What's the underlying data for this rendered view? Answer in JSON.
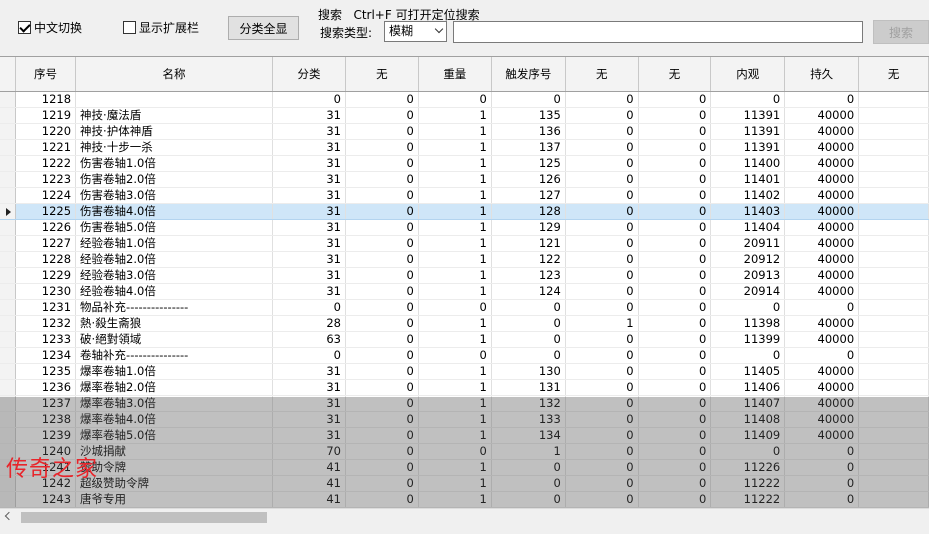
{
  "toolbar": {
    "chinese_toggle_label": "中文切换",
    "chinese_toggle_checked": true,
    "show_ext_label": "显示扩展栏",
    "show_ext_checked": false,
    "show_all_label": "分类全显",
    "search_title": "搜索   Ctrl+F 可打开定位搜索",
    "search_type_label": "搜索类型:",
    "search_type_value": "模糊",
    "search_value": "",
    "search_button": "搜索"
  },
  "table": {
    "columns": [
      "序号",
      "名称",
      "分类",
      "无",
      "重量",
      "触发序号",
      "无",
      "无",
      "内观",
      "持久",
      "无"
    ],
    "selected_index": 7,
    "rows": [
      [
        "1218",
        "",
        "0",
        "0",
        "0",
        "0",
        "0",
        "0",
        "0",
        "0",
        ""
      ],
      [
        "1219",
        "神技·魔法盾",
        "31",
        "0",
        "1",
        "135",
        "0",
        "0",
        "11391",
        "40000",
        ""
      ],
      [
        "1220",
        "神技·护体神盾",
        "31",
        "0",
        "1",
        "136",
        "0",
        "0",
        "11391",
        "40000",
        ""
      ],
      [
        "1221",
        "神技·十步一杀",
        "31",
        "0",
        "1",
        "137",
        "0",
        "0",
        "11391",
        "40000",
        ""
      ],
      [
        "1222",
        "伤害卷轴1.0倍",
        "31",
        "0",
        "1",
        "125",
        "0",
        "0",
        "11400",
        "40000",
        ""
      ],
      [
        "1223",
        "伤害卷轴2.0倍",
        "31",
        "0",
        "1",
        "126",
        "0",
        "0",
        "11401",
        "40000",
        ""
      ],
      [
        "1224",
        "伤害卷轴3.0倍",
        "31",
        "0",
        "1",
        "127",
        "0",
        "0",
        "11402",
        "40000",
        ""
      ],
      [
        "1225",
        "伤害卷轴4.0倍",
        "31",
        "0",
        "1",
        "128",
        "0",
        "0",
        "11403",
        "40000",
        ""
      ],
      [
        "1226",
        "伤害卷轴5.0倍",
        "31",
        "0",
        "1",
        "129",
        "0",
        "0",
        "11404",
        "40000",
        ""
      ],
      [
        "1227",
        "经验卷轴1.0倍",
        "31",
        "0",
        "1",
        "121",
        "0",
        "0",
        "20911",
        "40000",
        ""
      ],
      [
        "1228",
        "经验卷轴2.0倍",
        "31",
        "0",
        "1",
        "122",
        "0",
        "0",
        "20912",
        "40000",
        ""
      ],
      [
        "1229",
        "经验卷轴3.0倍",
        "31",
        "0",
        "1",
        "123",
        "0",
        "0",
        "20913",
        "40000",
        ""
      ],
      [
        "1230",
        "经验卷轴4.0倍",
        "31",
        "0",
        "1",
        "124",
        "0",
        "0",
        "20914",
        "40000",
        ""
      ],
      [
        "1231",
        "物品补充---------------",
        "0",
        "0",
        "0",
        "0",
        "0",
        "0",
        "0",
        "0",
        ""
      ],
      [
        "1232",
        "熱·殺生斋狼",
        "28",
        "0",
        "1",
        "0",
        "1",
        "0",
        "11398",
        "40000",
        ""
      ],
      [
        "1233",
        "破·絕對領域",
        "63",
        "0",
        "1",
        "0",
        "0",
        "0",
        "11399",
        "40000",
        ""
      ],
      [
        "1234",
        "卷轴补充---------------",
        "0",
        "0",
        "0",
        "0",
        "0",
        "0",
        "0",
        "0",
        ""
      ],
      [
        "1235",
        "爆率卷轴1.0倍",
        "31",
        "0",
        "1",
        "130",
        "0",
        "0",
        "11405",
        "40000",
        ""
      ],
      [
        "1236",
        "爆率卷轴2.0倍",
        "31",
        "0",
        "1",
        "131",
        "0",
        "0",
        "11406",
        "40000",
        ""
      ],
      [
        "1237",
        "爆率卷轴3.0倍",
        "31",
        "0",
        "1",
        "132",
        "0",
        "0",
        "11407",
        "40000",
        ""
      ],
      [
        "1238",
        "爆率卷轴4.0倍",
        "31",
        "0",
        "1",
        "133",
        "0",
        "0",
        "11408",
        "40000",
        ""
      ],
      [
        "1239",
        "爆率卷轴5.0倍",
        "31",
        "0",
        "1",
        "134",
        "0",
        "0",
        "11409",
        "40000",
        ""
      ],
      [
        "1240",
        "沙城捐献",
        "70",
        "0",
        "0",
        "1",
        "0",
        "0",
        "0",
        "0",
        ""
      ],
      [
        "1241",
        "赞助令牌",
        "41",
        "0",
        "1",
        "0",
        "0",
        "0",
        "11226",
        "0",
        ""
      ],
      [
        "1242",
        "超级赞助令牌",
        "41",
        "0",
        "1",
        "0",
        "0",
        "0",
        "11222",
        "0",
        ""
      ],
      [
        "1243",
        "唐爷专用",
        "41",
        "0",
        "1",
        "0",
        "0",
        "0",
        "11222",
        "0",
        ""
      ]
    ]
  },
  "watermark": "传奇之家",
  "colors": {
    "selected_row": "#cfe6f8",
    "watermark": "#e8242a"
  },
  "icons": {
    "row_indicator": "row-indicator-arrow-icon",
    "scroll_left": "scroll-left-arrow-icon"
  }
}
